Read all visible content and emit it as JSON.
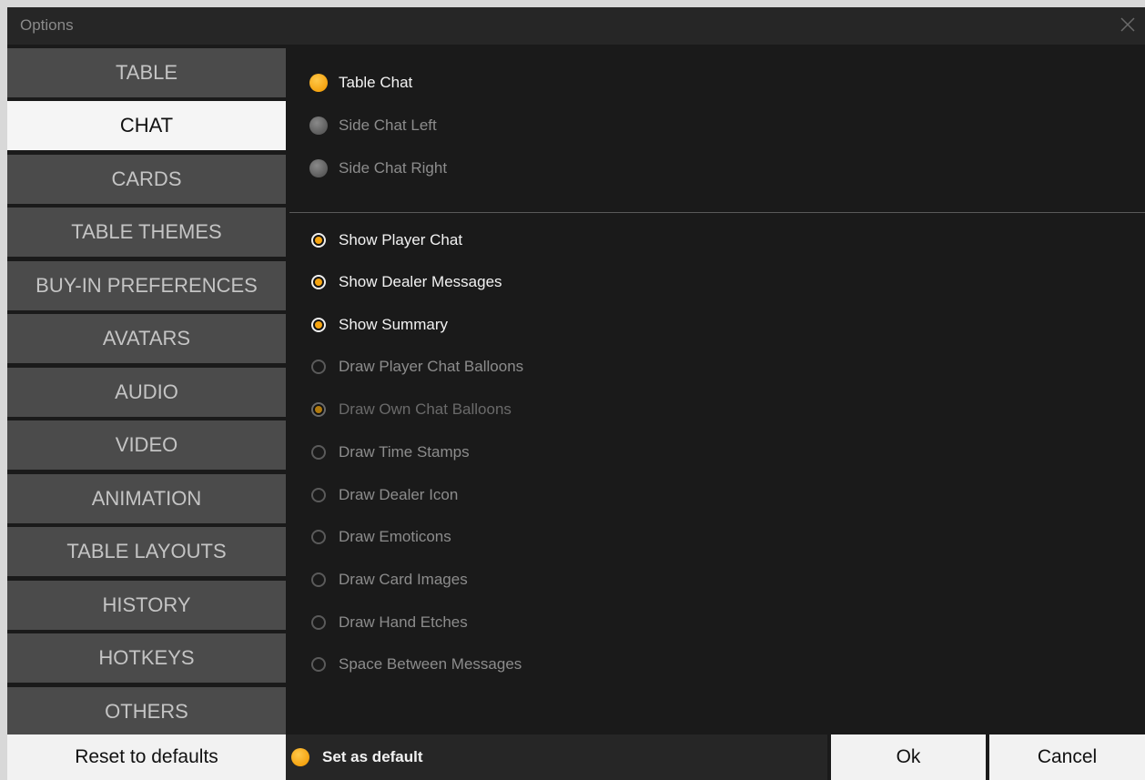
{
  "window": {
    "title": "Options",
    "close_icon": "close-icon"
  },
  "sidebar": {
    "items": [
      {
        "label": "TABLE"
      },
      {
        "label": "CHAT",
        "active": true
      },
      {
        "label": "CARDS"
      },
      {
        "label": "TABLE THEMES"
      },
      {
        "label": "BUY-IN PREFERENCES"
      },
      {
        "label": "AVATARS"
      },
      {
        "label": "AUDIO"
      },
      {
        "label": "VIDEO"
      },
      {
        "label": "ANIMATION"
      },
      {
        "label": "TABLE LAYOUTS"
      },
      {
        "label": "HISTORY"
      },
      {
        "label": "HOTKEYS"
      },
      {
        "label": "OTHERS"
      }
    ]
  },
  "chat_location": {
    "options": [
      {
        "label": "Table Chat",
        "selected": true
      },
      {
        "label": "Side Chat Left",
        "selected": false
      },
      {
        "label": "Side Chat Right",
        "selected": false
      }
    ]
  },
  "chat_settings": {
    "options": [
      {
        "label": "Show Player Chat",
        "checked": true,
        "enabled": true
      },
      {
        "label": "Show Dealer Messages",
        "checked": true,
        "enabled": true
      },
      {
        "label": "Show Summary",
        "checked": true,
        "enabled": true
      },
      {
        "label": "Draw Player Chat Balloons",
        "checked": false,
        "enabled": true
      },
      {
        "label": "Draw Own Chat Balloons",
        "checked": true,
        "enabled": false
      },
      {
        "label": "Draw Time Stamps",
        "checked": false,
        "enabled": true
      },
      {
        "label": "Draw Dealer Icon",
        "checked": false,
        "enabled": true
      },
      {
        "label": "Draw Emoticons",
        "checked": false,
        "enabled": true
      },
      {
        "label": "Draw Card Images",
        "checked": false,
        "enabled": true
      },
      {
        "label": "Draw Hand Etches",
        "checked": false,
        "enabled": true
      },
      {
        "label": "Space Between Messages",
        "checked": false,
        "enabled": true
      }
    ]
  },
  "footer": {
    "reset_label": "Reset to defaults",
    "set_default_label": "Set as default",
    "set_default_checked": true,
    "ok_label": "Ok",
    "cancel_label": "Cancel"
  },
  "colors": {
    "accent": "#f5a411",
    "background": "#1a1a1a",
    "nav_button": "#4b4b4b",
    "nav_active": "#f5f5f5"
  }
}
